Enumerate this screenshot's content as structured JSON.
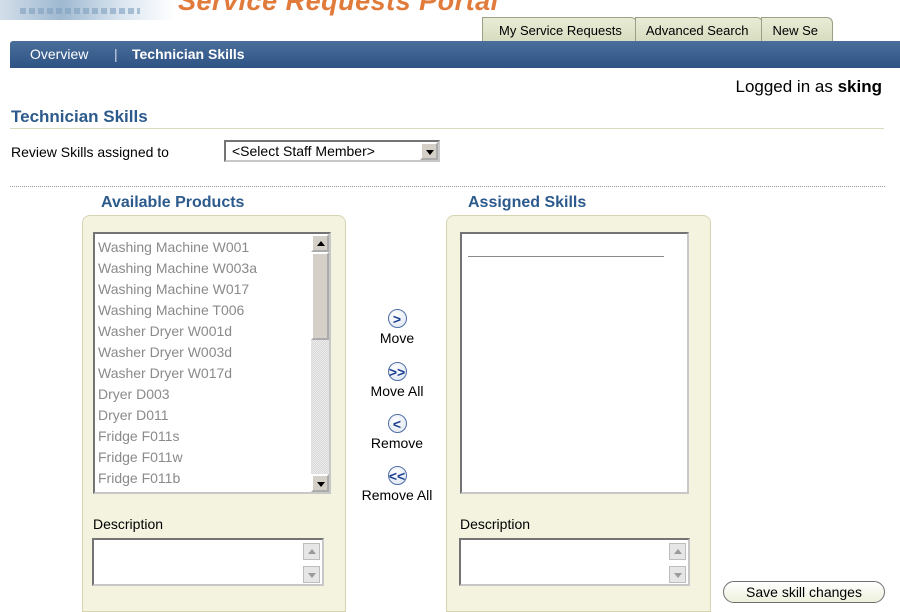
{
  "header": {
    "app_title": "Service Requests Portal",
    "tabs": [
      {
        "label": "My Service Requests"
      },
      {
        "label": "Advanced Search"
      },
      {
        "label": "New Se"
      }
    ]
  },
  "nav": {
    "overview": "Overview",
    "separator": "|",
    "technician_skills": "Technician Skills"
  },
  "session": {
    "prefix": "Logged in as",
    "user": "sking"
  },
  "page": {
    "title": "Technician Skills",
    "review_label": "Review Skills assigned to",
    "staff_select_value": "<Select Staff Member>"
  },
  "shuttle": {
    "available_header": "Available Products",
    "assigned_header": "Assigned Skills",
    "available_items": [
      "Washing Machine W001",
      "Washing Machine W003a",
      "Washing Machine W017",
      "Washing Machine T006",
      "Washer Dryer W001d",
      "Washer Dryer W003d",
      "Washer Dryer W017d",
      "Dryer D003",
      "Dryer D011",
      "Fridge F011s",
      "Fridge F011w",
      "Fridge F011b"
    ],
    "assigned_items": [],
    "controls": {
      "move": ">",
      "move_label": "Move",
      "move_all": ">>",
      "move_all_label": "Move All",
      "remove": "<",
      "remove_label": "Remove",
      "remove_all": "<<",
      "remove_all_label": "Remove All"
    },
    "available_description_label": "Description",
    "assigned_description_label": "Description"
  },
  "actions": {
    "save_label": "Save skill changes"
  }
}
